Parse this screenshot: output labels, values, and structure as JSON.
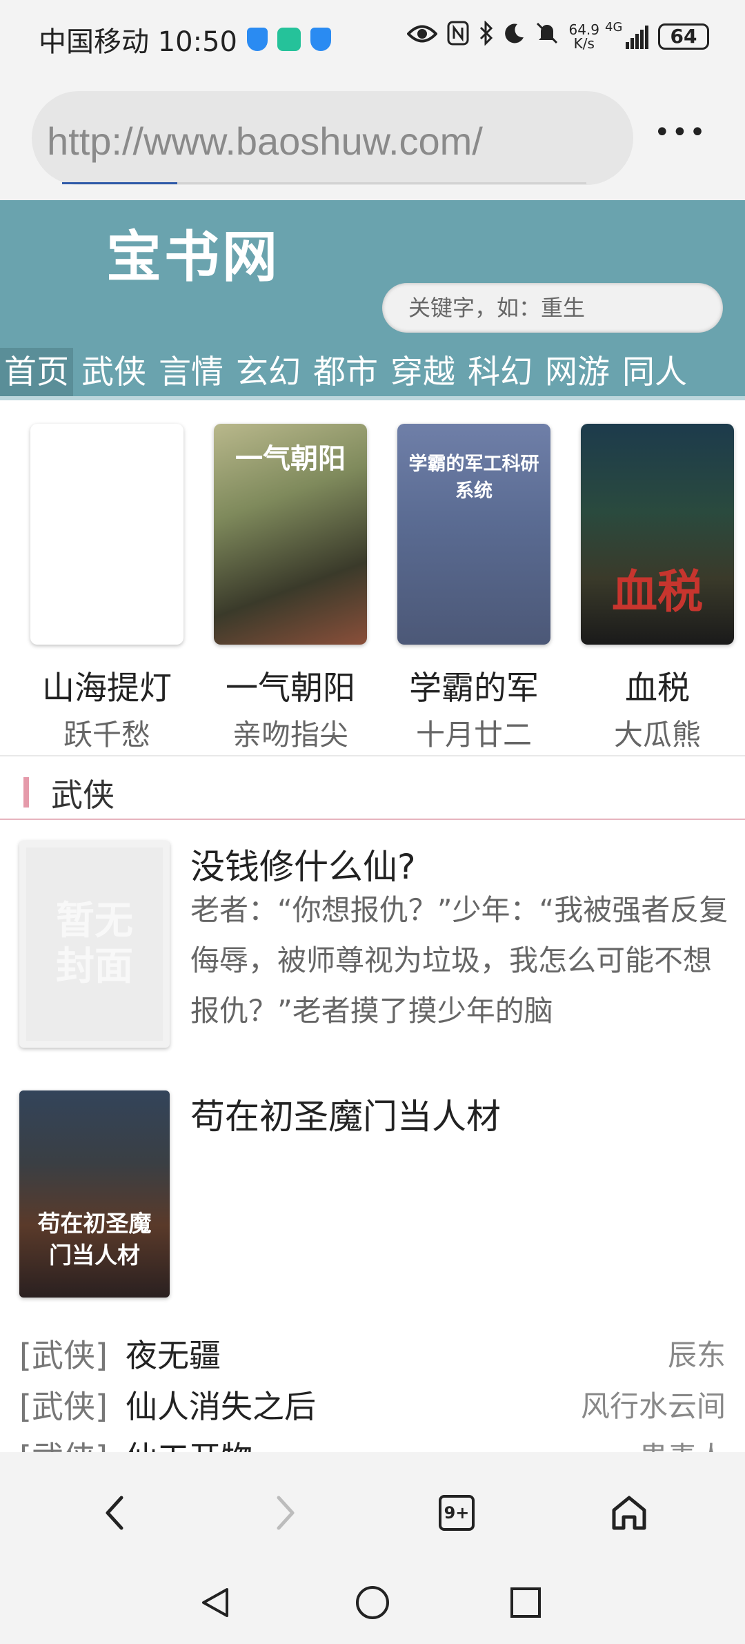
{
  "status_bar": {
    "carrier_time": "中国移动 10:50",
    "net_speed_value": "64.9",
    "net_speed_unit": "K/s",
    "network": "4G",
    "battery": "64",
    "icons": [
      "shield-icon",
      "app-icon",
      "shield-icon",
      "eye-icon",
      "nfc-icon",
      "bluetooth-icon",
      "moon-icon",
      "mute-icon",
      "signal-icon",
      "battery-icon"
    ]
  },
  "browser": {
    "url": "http://www.baoshuw.com/",
    "load_progress": 0.22,
    "menu_icon": "more-icon"
  },
  "site": {
    "logo": "宝书网",
    "search_placeholder": "关键字，如：重生",
    "nav": [
      "首页",
      "武侠",
      "言情",
      "玄幻",
      "都市",
      "穿越",
      "科幻",
      "网游",
      "同人"
    ]
  },
  "featured": [
    {
      "title": "山海提灯",
      "author": "跃千愁",
      "cover_text": ""
    },
    {
      "title": "一气朝阳",
      "author": "亲吻指尖",
      "cover_text": "一气朝阳"
    },
    {
      "title": "学霸的军",
      "author": "十月廿二",
      "cover_text": "学霸的军工科研系统"
    },
    {
      "title": "血税",
      "author": "大瓜熊",
      "cover_text": "血税"
    }
  ],
  "section": {
    "title": "武侠",
    "books": [
      {
        "title": "没钱修什么仙?",
        "intro": "老者：“你想报仇？”少年：“我被强者反复侮辱，被师尊视为垃圾，我怎么可能不想报仇？”老者摸了摸少年的脑",
        "cover_text": "暂无封面"
      },
      {
        "title": "苟在初圣魔门当人材",
        "intro": "",
        "cover_text": "苟在初圣魔门当人材"
      }
    ],
    "list": [
      {
        "category": "[武侠]",
        "name": "夜无疆",
        "author": "辰东"
      },
      {
        "category": "[武侠]",
        "name": "仙人消失之后",
        "author": "风行水云间"
      },
      {
        "category": "[武侠]",
        "name": "仙工开物",
        "author": "患毒人"
      }
    ]
  },
  "toolbar": {
    "tabs_count": "9+",
    "icons": [
      "back-icon",
      "forward-icon",
      "tabs-icon",
      "home-icon"
    ]
  },
  "system_nav": {
    "icons": [
      "system-back-icon",
      "system-home-icon",
      "system-recents-icon"
    ]
  }
}
